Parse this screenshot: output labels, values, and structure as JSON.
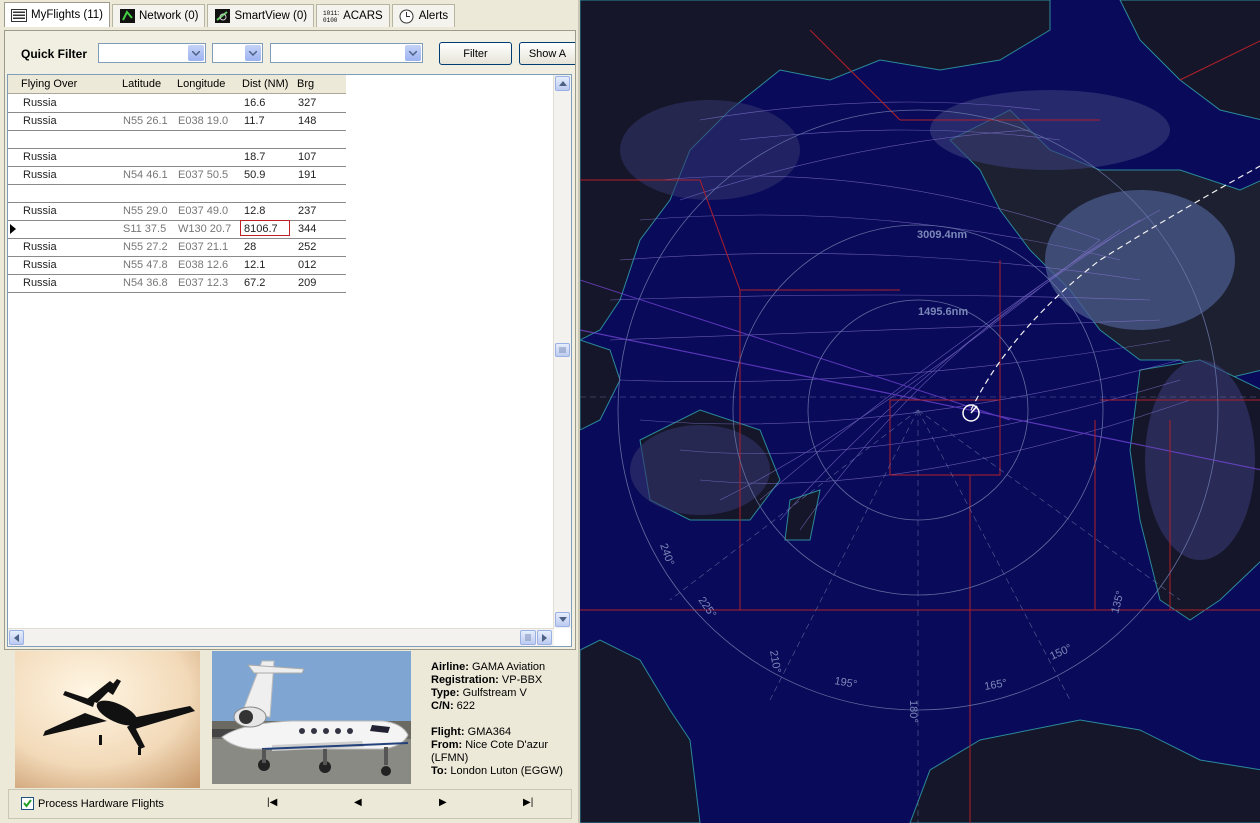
{
  "tabs": [
    {
      "label": "MyFlights (11)",
      "icon": "list-icon"
    },
    {
      "label": "Network (0)",
      "icon": "network-icon"
    },
    {
      "label": "SmartView (0)",
      "icon": "smartview-icon"
    },
    {
      "label": "ACARS",
      "icon": "acars-icon"
    },
    {
      "label": "Alerts",
      "icon": "clock-icon"
    }
  ],
  "quick_filter": {
    "label": "Quick Filter",
    "filter_button": "Filter",
    "show_all_button": "Show A"
  },
  "table": {
    "columns": [
      "Flying Over",
      "Latitude",
      "Longitude",
      "Dist (NM)",
      "Brg"
    ],
    "rows": [
      {
        "over": "Russia",
        "lat": "",
        "lon": "",
        "dist": "16.6",
        "brg": "327",
        "selected": false
      },
      {
        "over": "Russia",
        "lat": "N55 26.1",
        "lon": "E038 19.0",
        "dist": "11.7",
        "brg": "148",
        "selected": false
      },
      {
        "over": "",
        "lat": "",
        "lon": "",
        "dist": "",
        "brg": "",
        "selected": false
      },
      {
        "over": "Russia",
        "lat": "",
        "lon": "",
        "dist": "18.7",
        "brg": "107",
        "selected": false
      },
      {
        "over": "Russia",
        "lat": "N54 46.1",
        "lon": "E037 50.5",
        "dist": "50.9",
        "brg": "191",
        "selected": false
      },
      {
        "over": "",
        "lat": "",
        "lon": "",
        "dist": "",
        "brg": "",
        "selected": false
      },
      {
        "over": "Russia",
        "lat": "N55 29.0",
        "lon": "E037 49.0",
        "dist": "12.8",
        "brg": "237",
        "selected": false
      },
      {
        "over": "",
        "lat": "S11 37.5",
        "lon": "W130 20.7",
        "dist": "8106.7",
        "brg": "344",
        "selected": true
      },
      {
        "over": "Russia",
        "lat": "N55 27.2",
        "lon": "E037 21.1",
        "dist": "28",
        "brg": "252",
        "selected": false
      },
      {
        "over": "Russia",
        "lat": "N55 47.8",
        "lon": "E038 12.6",
        "dist": "12.1",
        "brg": "012",
        "selected": false
      },
      {
        "over": "Russia",
        "lat": "N54 36.8",
        "lon": "E037 12.3",
        "dist": "67.2",
        "brg": "209",
        "selected": false
      }
    ]
  },
  "aircraft": {
    "airline_label": "Airline:",
    "airline": "GAMA Aviation",
    "registration_label": "Registration:",
    "registration": "VP-BBX",
    "type_label": "Type:",
    "type": "Gulfstream V",
    "cn_label": "C/N:",
    "cn": "622",
    "flight_label": "Flight:",
    "flight": "GMA364",
    "from_label": "From:",
    "from": "Nice Cote D'azur (LFMN)",
    "to_label": "To:",
    "to": "London Luton (EGGW)"
  },
  "bottom": {
    "process_label": "Process Hardware Flights",
    "process_checked": true,
    "nav_first": "|◀",
    "nav_prev": "◀",
    "nav_next": "▶",
    "nav_last": "▶|"
  },
  "map": {
    "range_labels": [
      "3009.4nm",
      "1495.6nm"
    ],
    "bearing_labels": [
      "240°",
      "225°",
      "210°",
      "195°",
      "180°",
      "165°",
      "150°",
      "135°"
    ],
    "colors": {
      "ocean": "#0a0a5a",
      "land": "#1a1a2a",
      "routes": "#8a7ad8",
      "borders": "#b0202a",
      "coast": "#2a8a9a"
    }
  }
}
